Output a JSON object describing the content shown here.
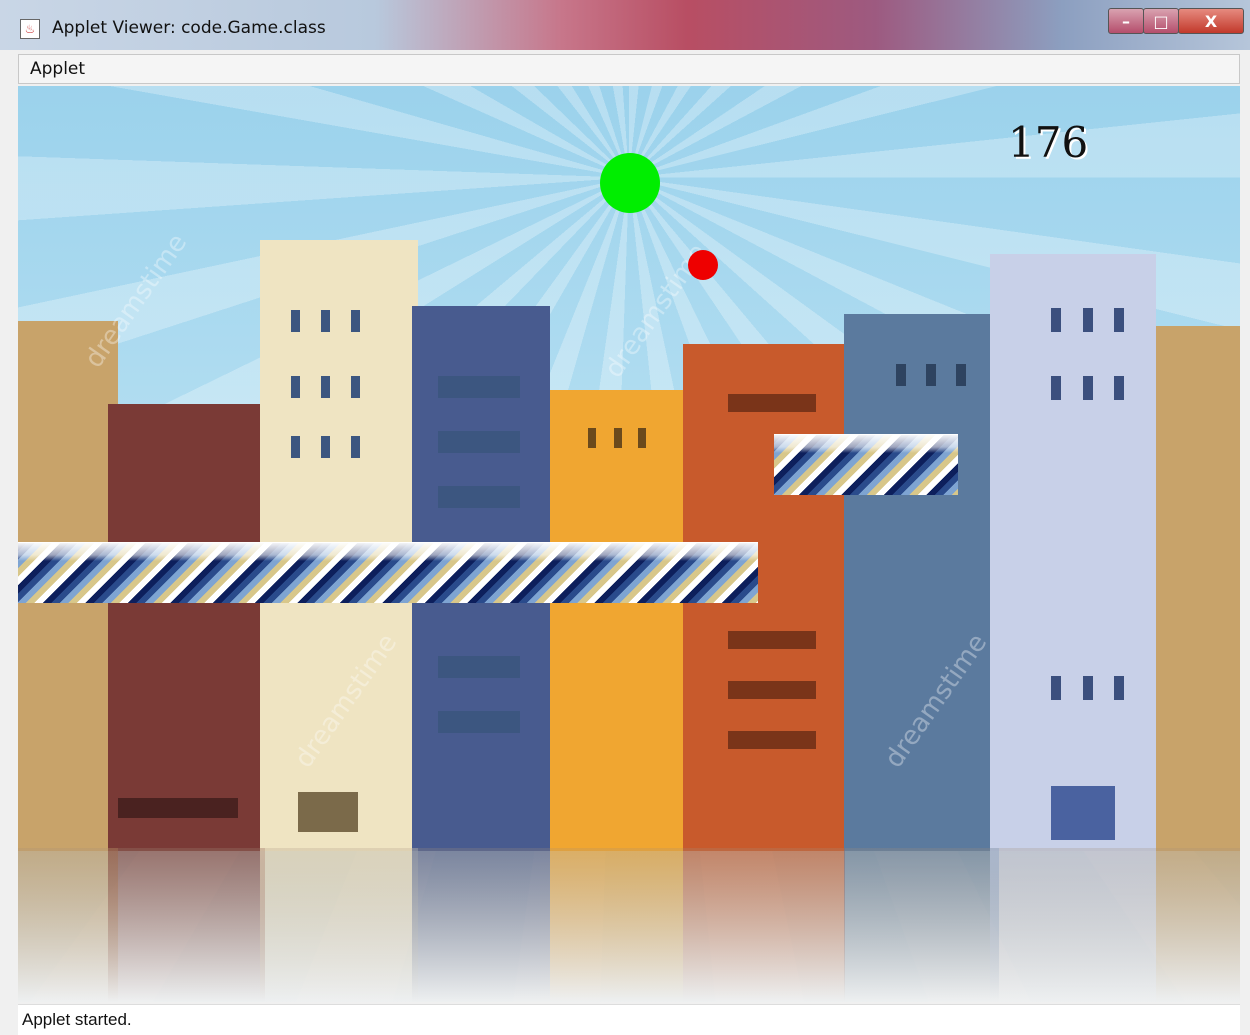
{
  "window": {
    "title": "Applet Viewer: code.Game.class",
    "minimize": "–",
    "maximize": "□",
    "close": "X"
  },
  "menu": {
    "items": [
      "Applet"
    ]
  },
  "game": {
    "score": "176",
    "watermark": "dreamstime",
    "colors": {
      "player_ball": "#00ee00",
      "enemy_ball": "#ee0000"
    }
  },
  "status": {
    "text": "Applet started."
  }
}
